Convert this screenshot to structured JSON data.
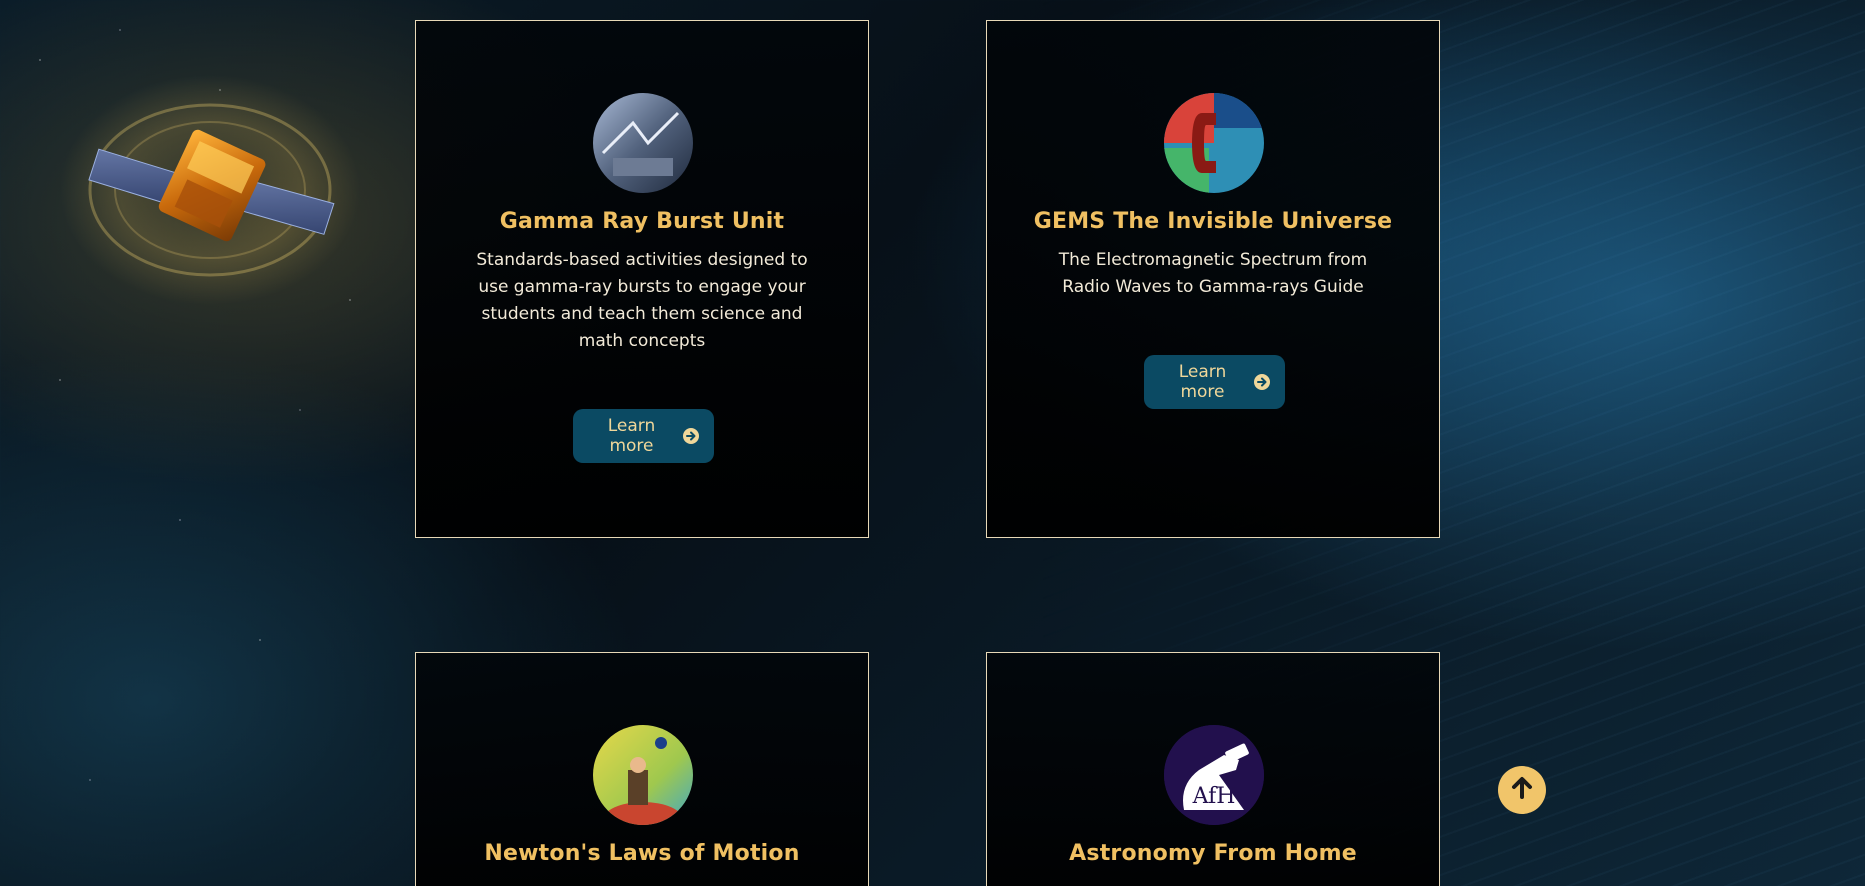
{
  "colors": {
    "card_title": "#f0c062",
    "card_text": "#f2ead8",
    "button_bg": "#0b4a63",
    "button_text": "#f0d79a",
    "card_border": "#e8d9b8",
    "scroll_top_bg": "#f1c56a"
  },
  "decor": {
    "satellite_icon": "satellite-illustration-icon"
  },
  "cards": [
    {
      "title": "Gamma Ray Burst Unit",
      "description": "Standards-based activities designed to use gamma-ray bursts to engage your students and teach them science and math concepts",
      "button_label": "Learn more",
      "button_icon": "arrow-circle-right-icon",
      "thumbnail_icon": "gamma-ray-burst-thumbnail-icon"
    },
    {
      "title": "GEMS The Invisible Universe",
      "description": "The Electromagnetic Spectrum from Radio Waves to Gamma-rays Guide",
      "button_label": "Learn more",
      "button_icon": "arrow-circle-right-icon",
      "thumbnail_icon": "gems-thumbnail-icon"
    },
    {
      "title": "Newton's Laws of Motion",
      "thumbnail_icon": "newton-thumbnail-icon"
    },
    {
      "title": "Astronomy From Home",
      "thumbnail_icon": "afh-logo-icon",
      "thumbnail_text": "AfH"
    }
  ],
  "scroll_top": {
    "icon": "arrow-up-circle-icon"
  }
}
